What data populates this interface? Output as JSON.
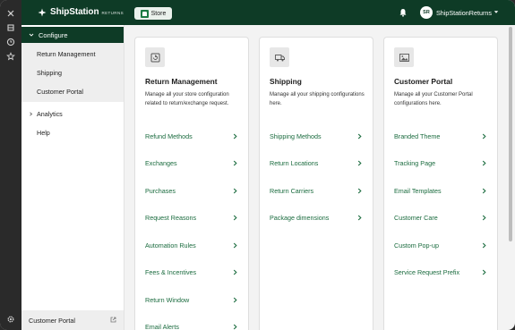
{
  "app": {
    "brand": "ShipStation",
    "brand_suffix": "RETURNS",
    "store_button": "Store",
    "avatar_initials": "SR",
    "account_name": "ShipStationReturns"
  },
  "sidebar": {
    "configure_label": "Configure",
    "configure_items": [
      "Return Management",
      "Shipping",
      "Customer Portal"
    ],
    "analytics_label": "Analytics",
    "help_label": "Help",
    "footer_label": "Customer Portal"
  },
  "cards": [
    {
      "title": "Return Management",
      "description": "Manage all your store configuration related to return/exchange request.",
      "links": [
        "Refund Methods",
        "Exchanges",
        "Purchases",
        "Request Reasons",
        "Automation Rules",
        "Fees & Incentives",
        "Return Window",
        "Email Alerts"
      ]
    },
    {
      "title": "Shipping",
      "description": "Manage all your shipping configurations here.",
      "links": [
        "Shipping Methods",
        "Return Locations",
        "Return Carriers",
        "Package dimensions"
      ]
    },
    {
      "title": "Customer Portal",
      "description": "Manage all your Customer Portal configurations here.",
      "links": [
        "Branded Theme",
        "Tracking Page",
        "Email Templates",
        "Customer Care",
        "Custom Pop-up",
        "Service Request Prefix"
      ]
    }
  ],
  "colors": {
    "header_bg": "#0e3b26",
    "link": "#1a6b3e",
    "rail_bg": "#2a2a2a"
  }
}
